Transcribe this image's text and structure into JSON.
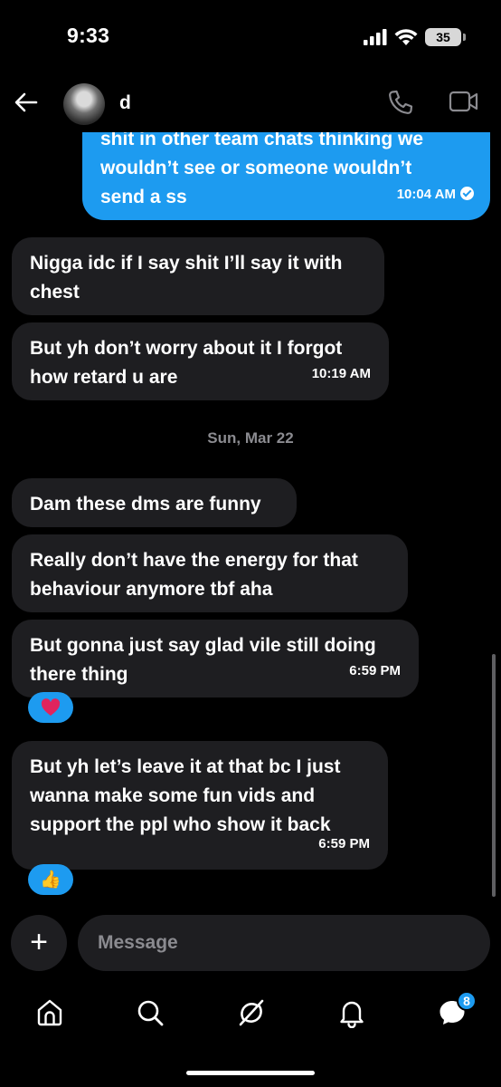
{
  "status_bar": {
    "time": "9:33",
    "battery": "35"
  },
  "header": {
    "contact_name": "d"
  },
  "messages": [
    {
      "text": "shit in other team chats thinking we\nwouldn’t see or someone wouldn’t\nsend a ss",
      "time": "10:04 AM",
      "direction": "sent"
    },
    {
      "text": "Nigga idc if I say shit I’ll say it with\nchest",
      "time": "",
      "direction": "received"
    },
    {
      "text": "But yh don’t worry about it I forgot\nhow retard u are",
      "time": "10:19 AM",
      "direction": "received"
    },
    {
      "text": "Dam these dms are funny",
      "time": "",
      "direction": "received"
    },
    {
      "text": "Really don’t have the energy for that\nbehaviour anymore tbf aha",
      "time": "",
      "direction": "received"
    },
    {
      "text": "But gonna just say glad vile still doing\nthere thing",
      "time": "6:59 PM",
      "direction": "received"
    },
    {
      "text": "But yh let’s leave it at that bc I just\nwanna make some fun vids and\nsupport the ppl who show it back",
      "time": "6:59 PM",
      "direction": "received"
    }
  ],
  "date_separator": "Sun, Mar 22",
  "reactions": [
    {
      "emoji": "heart",
      "after_message": 5
    },
    {
      "emoji": "thumbs-up",
      "after_message": 6
    }
  ],
  "composer": {
    "placeholder": "Message"
  },
  "tabbar": {
    "messages_badge": "8"
  },
  "colors": {
    "accent": "#1d9bf0",
    "received_bubble": "#1e1e21",
    "background": "#000000",
    "muted_text": "#8b8b90"
  }
}
